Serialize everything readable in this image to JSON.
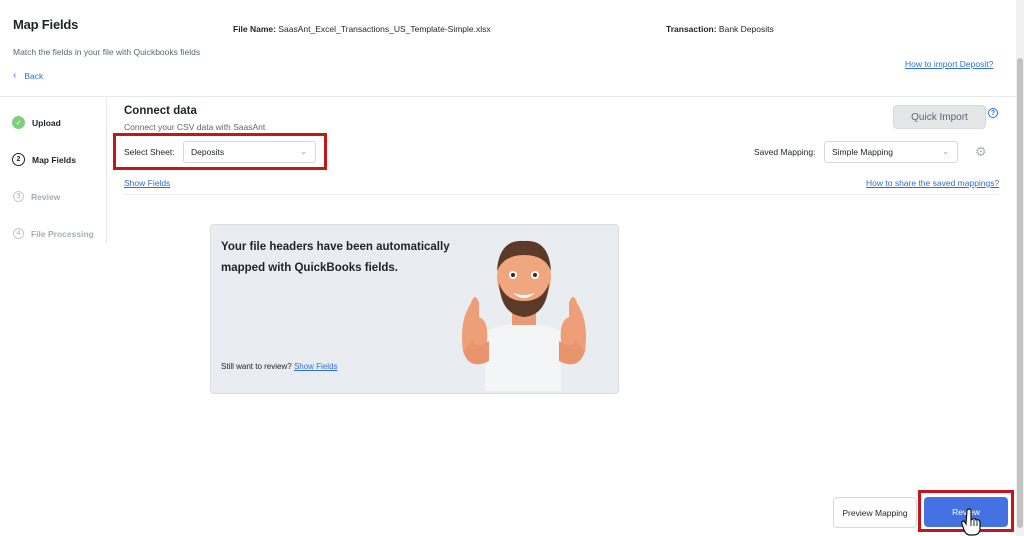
{
  "header": {
    "title": "Map Fields",
    "subtitle": "Match the fields in your file with Quickbooks fields",
    "back_label": "Back",
    "file_name_label": "File Name:",
    "file_name_value": "SaasAnt_Excel_Transactions_US_Template-Simple.xlsx",
    "transaction_label": "Transaction:",
    "transaction_value": "Bank Deposits",
    "help_link": "How to import Deposit?"
  },
  "steps": [
    {
      "number": "✓",
      "label": "Upload",
      "state": "done"
    },
    {
      "number": "2",
      "label": "Map Fields",
      "state": "active"
    },
    {
      "number": "3",
      "label": "Review",
      "state": "pending"
    },
    {
      "number": "4",
      "label": "File Processing",
      "state": "pending"
    }
  ],
  "connect": {
    "title": "Connect data",
    "subtitle": "Connect your CSV data with SaasAnt",
    "sheet_label": "Select Sheet:",
    "sheet_value": "Deposits",
    "quick_import": "Quick Import",
    "saved_mapping_label": "Saved Mapping:",
    "saved_mapping_value": "Simple Mapping",
    "show_fields": "Show Fields",
    "share_link": "How to share the saved mappings?"
  },
  "card": {
    "message": "Your file headers have been automatically mapped with QuickBooks fields.",
    "review_prompt": "Still want to review?",
    "review_link": "Show Fields"
  },
  "footer": {
    "preview_label": "Preview Mapping",
    "review_label": "Review"
  },
  "colors": {
    "accent": "#4472e2",
    "link": "#2f6fd6",
    "highlight": "#c4161c",
    "success": "#7fd07b"
  }
}
